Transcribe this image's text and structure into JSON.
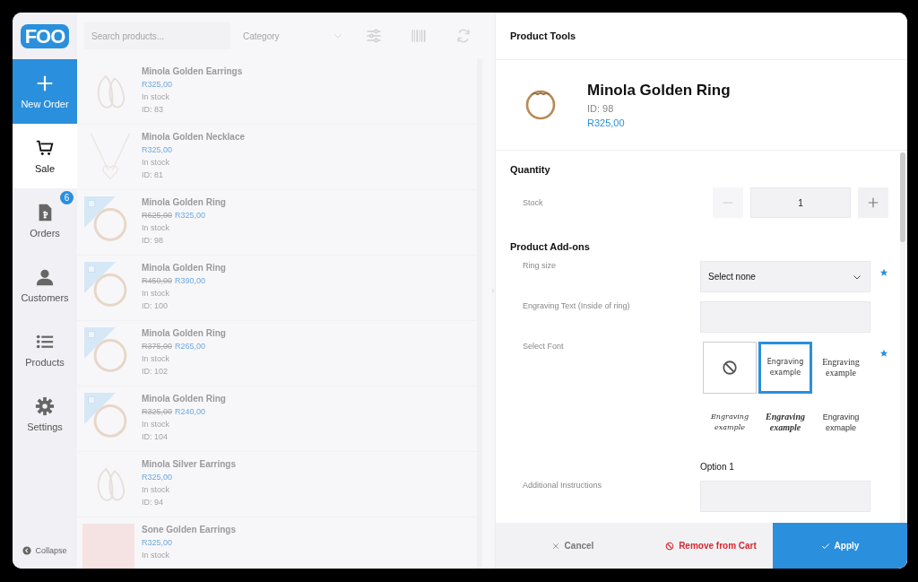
{
  "logo": "FOO",
  "nav": [
    {
      "label": "New Order",
      "kind": "action",
      "selected": false
    },
    {
      "label": "Sale",
      "kind": "item",
      "selected": true
    },
    {
      "label": "Orders",
      "kind": "item",
      "selected": false,
      "badge": "6"
    },
    {
      "label": "Customers",
      "kind": "item",
      "selected": false
    },
    {
      "label": "Products",
      "kind": "item",
      "selected": false
    },
    {
      "label": "Settings",
      "kind": "item",
      "selected": false
    }
  ],
  "collapse": "Collapse",
  "toolbar": {
    "search_placeholder": "Search products...",
    "category_placeholder": "Category"
  },
  "products": [
    {
      "name": "Minola Golden Earrings",
      "price": "R325,00",
      "stock": "In stock",
      "id": "ID: 83",
      "sale": false
    },
    {
      "name": "Minola Golden Necklace",
      "price": "R325,00",
      "stock": "In stock",
      "id": "ID: 81",
      "sale": false
    },
    {
      "name": "Minola Golden Ring",
      "old_price": "R625,00",
      "price": "R325,00",
      "stock": "In stock",
      "id": "ID: 98",
      "sale": true
    },
    {
      "name": "Minola Golden Ring",
      "old_price": "R450,00",
      "price": "R390,00",
      "stock": "In stock",
      "id": "ID: 100",
      "sale": true
    },
    {
      "name": "Minola Golden Ring",
      "old_price": "R375,00",
      "price": "R265,00",
      "stock": "In stock",
      "id": "ID: 102",
      "sale": true
    },
    {
      "name": "Minola Golden Ring",
      "old_price": "R325,00",
      "price": "R240,00",
      "stock": "In stock",
      "id": "ID: 104",
      "sale": true
    },
    {
      "name": "Minola Silver Earrings",
      "price": "R325,00",
      "stock": "In stock",
      "id": "ID: 94",
      "sale": false
    },
    {
      "name": "Sone Golden Earrings",
      "price": "R325,00",
      "stock": "In stock",
      "sale": false
    }
  ],
  "panel": {
    "title": "Product Tools",
    "product": {
      "name": "Minola Golden Ring",
      "id": "ID: 98",
      "price": "R325,00"
    },
    "quantity": {
      "heading": "Quantity",
      "label": "Stock",
      "value": "1"
    },
    "addons_heading": "Product Add-ons",
    "fields": [
      {
        "kind": "select",
        "label": "Ring size",
        "value": "Select none",
        "required": true
      },
      {
        "kind": "text",
        "label": "Engraving Text (Inside of ring)",
        "required": false
      },
      {
        "kind": "fonts",
        "label": "Select Font",
        "required": true,
        "caption": "Option 1",
        "options": [
          {
            "kind": "none",
            "selected": false
          },
          {
            "kind": "sample",
            "text": "Engraving example",
            "selected": true
          },
          {
            "kind": "sample",
            "text": "Engraving example",
            "selected": false
          },
          {
            "kind": "sample",
            "text": "Engraving example",
            "selected": false
          },
          {
            "kind": "sample",
            "text": "Engraving example",
            "selected": false
          },
          {
            "kind": "sample",
            "text": "Engraving exmaple",
            "selected": false
          }
        ]
      },
      {
        "kind": "text",
        "label": "Additional Instructions",
        "required": false
      }
    ]
  },
  "footer": [
    {
      "kind": "cancel",
      "label": "Cancel"
    },
    {
      "kind": "remove",
      "label": "Remove from Cart"
    },
    {
      "kind": "apply",
      "label": "Apply"
    }
  ]
}
